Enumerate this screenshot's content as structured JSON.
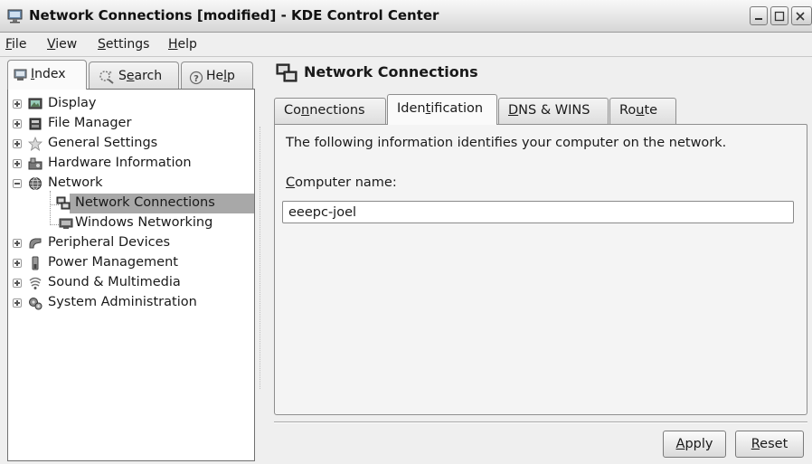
{
  "window": {
    "title": "Network Connections [modified] - KDE Control Center"
  },
  "menu": {
    "file": {
      "pre": "",
      "key": "F",
      "post": "ile"
    },
    "view": {
      "pre": "",
      "key": "V",
      "post": "iew"
    },
    "settings": {
      "pre": "",
      "key": "S",
      "post": "ettings"
    },
    "help": {
      "pre": "",
      "key": "H",
      "post": "elp"
    }
  },
  "sidebar_tabs": {
    "index": {
      "pre": "",
      "key": "I",
      "post": "ndex"
    },
    "search": {
      "pre": "S",
      "key": "e",
      "post": "arch"
    },
    "help": {
      "pre": "He",
      "key": "l",
      "post": "p"
    }
  },
  "tree": [
    {
      "label": "Display",
      "icon": "display-icon"
    },
    {
      "label": "File Manager",
      "icon": "file-manager-icon"
    },
    {
      "label": "General Settings",
      "icon": "star-icon"
    },
    {
      "label": "Hardware Information",
      "icon": "hardware-icon"
    },
    {
      "label": "Network",
      "icon": "network-globe-icon"
    },
    {
      "label": "Network Connections",
      "icon": "network-connections-icon",
      "selected": true
    },
    {
      "label": "Windows Networking",
      "icon": "windows-networking-icon"
    },
    {
      "label": "Peripheral Devices",
      "icon": "peripheral-icon"
    },
    {
      "label": "Power Management",
      "icon": "power-icon"
    },
    {
      "label": "Sound & Multimedia",
      "icon": "sound-icon"
    },
    {
      "label": "System Administration",
      "icon": "system-admin-icon"
    }
  ],
  "module": {
    "title": "Network Connections",
    "tabs": {
      "connections": {
        "pre": "Co",
        "key": "n",
        "post": "nections"
      },
      "identification": {
        "pre": "Iden",
        "key": "t",
        "post": "ification"
      },
      "dns": {
        "pre": "",
        "key": "D",
        "post": "NS & WINS"
      },
      "route": {
        "pre": "Ro",
        "key": "u",
        "post": "te"
      }
    },
    "info_text": "The following information identifies your computer on the network.",
    "computer_name_label": {
      "pre": "",
      "key": "C",
      "post": "omputer name:"
    },
    "computer_name_value": "eeepc-joel"
  },
  "buttons": {
    "apply": {
      "pre": "",
      "key": "A",
      "post": "pply"
    },
    "reset": {
      "pre": "",
      "key": "R",
      "post": "eset"
    }
  },
  "colors": {
    "selection": "#a8a8a8",
    "tree_background": "#ffffff",
    "window_background": "#efefef"
  }
}
